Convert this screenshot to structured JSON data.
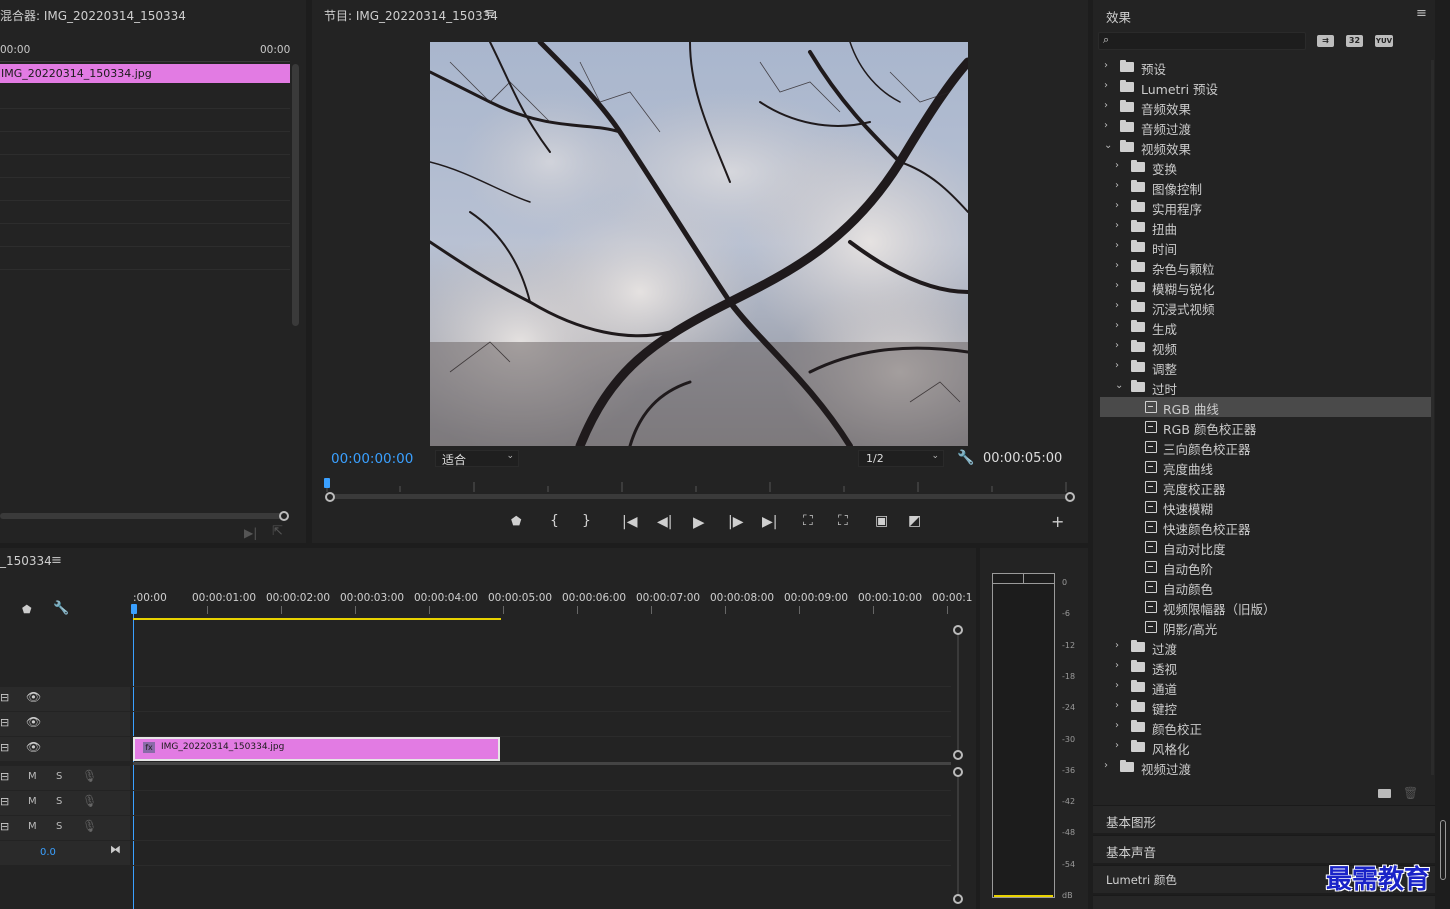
{
  "source_panel": {
    "title": "混合器: IMG_20220314_150334",
    "tc_left": "00:00",
    "tc_right": "00:00",
    "clip_name": "IMG_20220314_150334.jpg"
  },
  "program_panel": {
    "title": "节目: IMG_20220314_150334",
    "current_time": "00:00:00:00",
    "fit_label": "适合",
    "resolution": "1/2",
    "duration": "00:00:05:00"
  },
  "effects_panel": {
    "title": "效果",
    "search_placeholder": "",
    "badges": [
      "32",
      "YUV"
    ],
    "tree": [
      {
        "label": "预设",
        "level": 0,
        "type": "preset",
        "open": false
      },
      {
        "label": "Lumetri 预设",
        "level": 0,
        "type": "preset",
        "open": false
      },
      {
        "label": "音频效果",
        "level": 0,
        "type": "folder",
        "open": false
      },
      {
        "label": "音频过渡",
        "level": 0,
        "type": "folder",
        "open": false
      },
      {
        "label": "视频效果",
        "level": 0,
        "type": "folder",
        "open": true
      },
      {
        "label": "变换",
        "level": 1,
        "type": "folder",
        "open": false
      },
      {
        "label": "图像控制",
        "level": 1,
        "type": "folder",
        "open": false
      },
      {
        "label": "实用程序",
        "level": 1,
        "type": "folder",
        "open": false
      },
      {
        "label": "扭曲",
        "level": 1,
        "type": "folder",
        "open": false
      },
      {
        "label": "时间",
        "level": 1,
        "type": "folder",
        "open": false
      },
      {
        "label": "杂色与颗粒",
        "level": 1,
        "type": "folder",
        "open": false
      },
      {
        "label": "模糊与锐化",
        "level": 1,
        "type": "folder",
        "open": false
      },
      {
        "label": "沉浸式视频",
        "level": 1,
        "type": "folder",
        "open": false
      },
      {
        "label": "生成",
        "level": 1,
        "type": "folder",
        "open": false
      },
      {
        "label": "视频",
        "level": 1,
        "type": "folder",
        "open": false
      },
      {
        "label": "调整",
        "level": 1,
        "type": "folder",
        "open": false
      },
      {
        "label": "过时",
        "level": 1,
        "type": "folder",
        "open": true
      },
      {
        "label": "RGB 曲线",
        "level": 2,
        "type": "effect",
        "selected": true
      },
      {
        "label": "RGB 颜色校正器",
        "level": 2,
        "type": "effect"
      },
      {
        "label": "三向颜色校正器",
        "level": 2,
        "type": "effect"
      },
      {
        "label": "亮度曲线",
        "level": 2,
        "type": "effect"
      },
      {
        "label": "亮度校正器",
        "level": 2,
        "type": "effect"
      },
      {
        "label": "快速模糊",
        "level": 2,
        "type": "effect"
      },
      {
        "label": "快速颜色校正器",
        "level": 2,
        "type": "effect"
      },
      {
        "label": "自动对比度",
        "level": 2,
        "type": "effect"
      },
      {
        "label": "自动色阶",
        "level": 2,
        "type": "effect"
      },
      {
        "label": "自动颜色",
        "level": 2,
        "type": "effect"
      },
      {
        "label": "视频限幅器（旧版）",
        "level": 2,
        "type": "effect"
      },
      {
        "label": "阴影/高光",
        "level": 2,
        "type": "effect"
      },
      {
        "label": "过渡",
        "level": 1,
        "type": "folder",
        "open": false
      },
      {
        "label": "透视",
        "level": 1,
        "type": "folder",
        "open": false
      },
      {
        "label": "通道",
        "level": 1,
        "type": "folder",
        "open": false
      },
      {
        "label": "键控",
        "level": 1,
        "type": "folder",
        "open": false
      },
      {
        "label": "颜色校正",
        "level": 1,
        "type": "folder",
        "open": false
      },
      {
        "label": "风格化",
        "level": 1,
        "type": "folder",
        "open": false
      },
      {
        "label": "视频过渡",
        "level": 0,
        "type": "folder",
        "open": false
      }
    ],
    "collapsed_panels": [
      "基本图形",
      "基本声音",
      "Lumetri 颜色"
    ]
  },
  "timeline": {
    "title": "_150334",
    "ruler": [
      ":00:00",
      "00:00:01:00",
      "00:00:02:00",
      "00:00:03:00",
      "00:00:04:00",
      "00:00:05:00",
      "00:00:06:00",
      "00:00:07:00",
      "00:00:08:00",
      "00:00:09:00",
      "00:00:10:00",
      "00:00:1"
    ],
    "clip_name": "IMG_20220314_150334.jpg",
    "clip_badge": "fx",
    "audio_m": "M",
    "audio_s": "S",
    "volume_value": "0.0"
  },
  "audio_meter": {
    "ticks": [
      "0",
      "-6",
      "-12",
      "-18",
      "-24",
      "-30",
      "-36",
      "-42",
      "-48",
      "-54",
      "dB"
    ]
  },
  "watermark": "最需教育",
  "colors": {
    "clip_pink": "#e27be3",
    "timecode_blue": "#3aa0ff",
    "work_area_yellow": "#e8d200",
    "panel_bg": "#232323"
  }
}
